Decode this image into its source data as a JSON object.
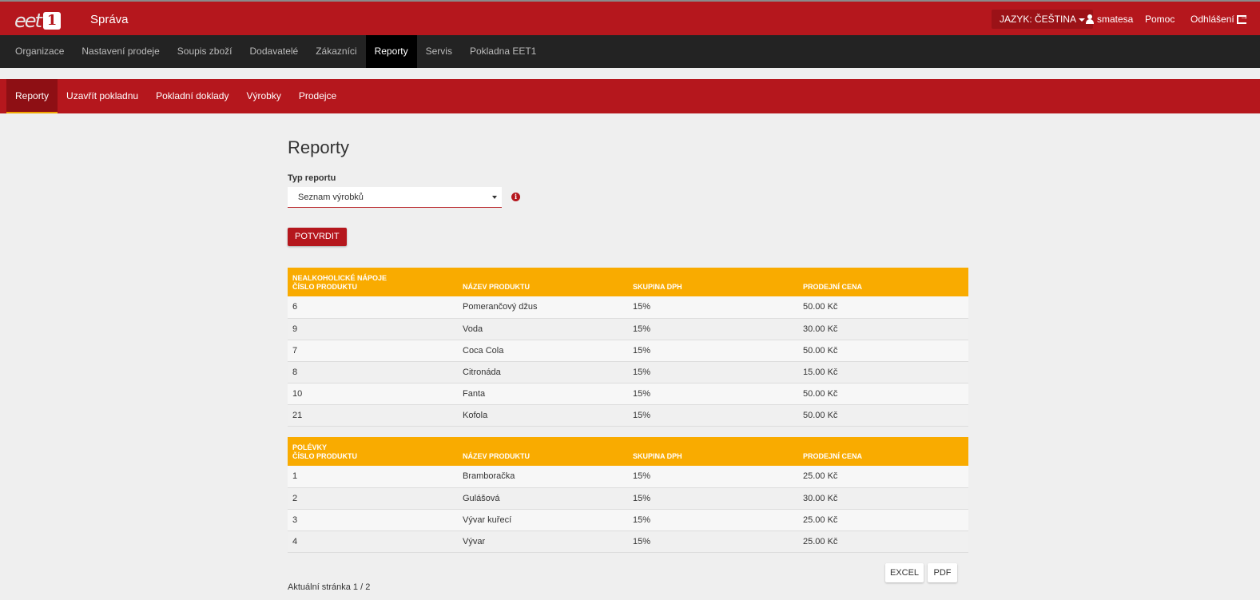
{
  "brand": {
    "logo_text": "eet",
    "logo_number": "1",
    "app_title": "Správa",
    "primary_color": "#b5171d",
    "accent_color": "#f9ab00"
  },
  "topbar": {
    "language": "JAZYK: ČEŠTINA",
    "user": "smatesa",
    "help": "Pomoc",
    "logout": "Odhlášení"
  },
  "main_nav": {
    "items": [
      "Organizace",
      "Nastavení prodeje",
      "Soupis zboží",
      "Dodavatelé",
      "Zákazníci",
      "Reporty",
      "Servis",
      "Pokladna EET1"
    ],
    "active": "Reporty"
  },
  "sub_nav": {
    "items": [
      "Reporty",
      "Uzavřít pokladnu",
      "Pokladní doklady",
      "Výrobky",
      "Prodejce"
    ],
    "active": "Reporty"
  },
  "page": {
    "title": "Reporty",
    "report_type_label": "Typ reportu",
    "report_type_value": "Seznam výrobků",
    "confirm_button": "POTVRDIT"
  },
  "tables": [
    {
      "group": "NEALKOHOLICKÉ NÁPOJE",
      "headers": [
        "ČÍSLO PRODUKTU",
        "NÁZEV PRODUKTU",
        "SKUPINA DPH",
        "PRODEJNÍ CENA"
      ],
      "rows": [
        [
          "6",
          "Pomerančový džus",
          "15%",
          "50.00 Kč"
        ],
        [
          "9",
          "Voda",
          "15%",
          "30.00 Kč"
        ],
        [
          "7",
          "Coca Cola",
          "15%",
          "50.00 Kč"
        ],
        [
          "8",
          "Citronáda",
          "15%",
          "15.00 Kč"
        ],
        [
          "10",
          "Fanta",
          "15%",
          "50.00 Kč"
        ],
        [
          "21",
          "Kofola",
          "15%",
          "50.00 Kč"
        ]
      ]
    },
    {
      "group": "POLÉVKY",
      "headers": [
        "ČÍSLO PRODUKTU",
        "NÁZEV PRODUKTU",
        "SKUPINA DPH",
        "PRODEJNÍ CENA"
      ],
      "rows": [
        [
          "1",
          "Bramboračka",
          "15%",
          "25.00 Kč"
        ],
        [
          "2",
          "Gulášová",
          "15%",
          "30.00 Kč"
        ],
        [
          "3",
          "Vývar kuřecí",
          "15%",
          "25.00 Kč"
        ],
        [
          "4",
          "Vývar",
          "15%",
          "25.00 Kč"
        ]
      ]
    }
  ],
  "export": {
    "excel": "EXCEL",
    "pdf": "PDF"
  },
  "pager": "Aktuální stránka 1 / 2"
}
